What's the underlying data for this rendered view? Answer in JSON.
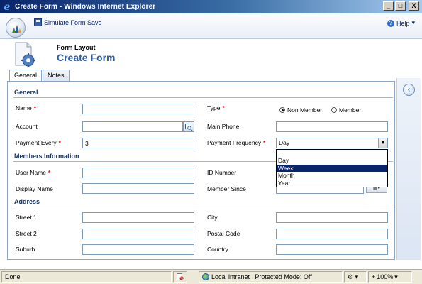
{
  "window": {
    "title": "Create Form - Windows Internet Explorer",
    "min_label": "_",
    "max_label": "□",
    "close_label": "X"
  },
  "toolbar": {
    "simulate_label": "Simulate Form Save",
    "help_label": "Help",
    "help_arrow": "▾"
  },
  "header": {
    "form_layout_label": "Form Layout",
    "form_title": "Create Form"
  },
  "tabs": [
    {
      "label": "General",
      "active": true
    },
    {
      "label": "Notes",
      "active": false
    }
  ],
  "sections": {
    "general": "General",
    "members": "Members Information",
    "address": "Address"
  },
  "fields": {
    "name": {
      "label": "Name",
      "value": "",
      "required": "*"
    },
    "account": {
      "label": "Account",
      "value": ""
    },
    "payment_every": {
      "label": "Payment Every",
      "value": "3",
      "required": "*"
    },
    "type": {
      "label": "Type",
      "required": "*",
      "options": [
        "Non Member",
        "Member"
      ],
      "selected": "Non Member"
    },
    "main_phone": {
      "label": "Main Phone",
      "value": ""
    },
    "payment_frequency": {
      "label": "Payment Frequency",
      "required": "*",
      "value": "Day",
      "options": [
        "Day",
        "Week",
        "Month",
        "Year"
      ],
      "highlighted": "Week"
    },
    "user_name": {
      "label": "User Name",
      "value": "",
      "required": "*"
    },
    "display_name": {
      "label": "Display Name",
      "value": ""
    },
    "id_number": {
      "label": "ID Number",
      "value": ""
    },
    "member_since": {
      "label": "Member Since",
      "value": ""
    },
    "street1": {
      "label": "Street 1",
      "value": ""
    },
    "street2": {
      "label": "Street 2",
      "value": ""
    },
    "suburb": {
      "label": "Suburb",
      "value": ""
    },
    "city": {
      "label": "City",
      "value": ""
    },
    "postal_code": {
      "label": "Postal Code",
      "value": ""
    },
    "country": {
      "label": "Country",
      "value": ""
    }
  },
  "statusbar": {
    "status": "Done",
    "zone": "Local intranet | Protected Mode: Off",
    "zoom": "100%",
    "zoom_prefix": "+",
    "zoom_arrow": "▾",
    "tool_arrow": "▾"
  },
  "colors": {
    "accent": "#2a5ea8",
    "required": "#e00000",
    "titlebar": "#0a246a"
  }
}
